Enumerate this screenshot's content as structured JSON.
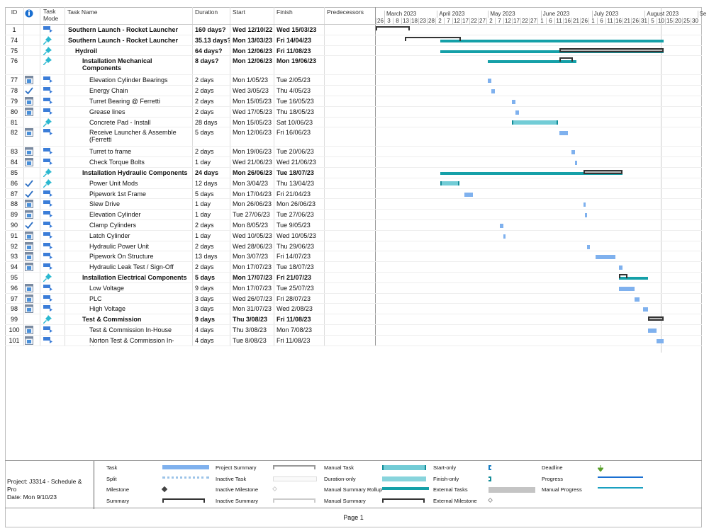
{
  "columns": {
    "id": "ID",
    "info": "i",
    "mode": "Task Mode",
    "name": "Task Name",
    "duration": "Duration",
    "start": "Start",
    "finish": "Finish",
    "predecessors": "Predecessors"
  },
  "timescale": {
    "origin": "2023-02-24",
    "months": [
      {
        "label": "March 2023",
        "date": "2023-03-01"
      },
      {
        "label": "April 2023",
        "date": "2023-04-01"
      },
      {
        "label": "May 2023",
        "date": "2023-05-01"
      },
      {
        "label": "June 2023",
        "date": "2023-06-01"
      },
      {
        "label": "July 2023",
        "date": "2023-07-01"
      },
      {
        "label": "August 2023",
        "date": "2023-08-01"
      },
      {
        "label": "Se",
        "date": "2023-09-01"
      }
    ],
    "days": [
      "26",
      "3",
      "8",
      "13",
      "18",
      "23",
      "28",
      "2",
      "7",
      "12",
      "17",
      "22",
      "27",
      "2",
      "7",
      "12",
      "17",
      "22",
      "27",
      "1",
      "6",
      "11",
      "16",
      "21",
      "26",
      "1",
      "6",
      "11",
      "16",
      "21",
      "26",
      "31",
      "5",
      "10",
      "15",
      "20",
      "25",
      "30"
    ]
  },
  "colors": {
    "task": "#7fb1ee",
    "manual_task": "#72ccd6",
    "rollup": "#15a0a8",
    "summary": "#333333",
    "info": "#1a6fd1",
    "pin": "#2ab8d0"
  },
  "rows": [
    {
      "id": "1",
      "indicator": "",
      "mode": "auto",
      "name": "Southern Launch - Rocket Launcher",
      "duration": "160 days?",
      "start": "Wed 12/10/22",
      "finish": "Wed 15/03/23",
      "bold": true,
      "level": 0,
      "bars": [
        {
          "type": "summary",
          "from": "2023-02-24",
          "to": "2023-03-15"
        }
      ]
    },
    {
      "id": "74",
      "indicator": "",
      "mode": "manual",
      "name": "Southern Launch - Rocket Launcher",
      "duration": "35.13 days?",
      "start": "Mon 13/03/23",
      "finish": "Fri 14/04/23",
      "bold": true,
      "level": 0,
      "bars": [
        {
          "type": "rollup",
          "from": "2023-04-03",
          "to": "2023-08-11"
        },
        {
          "type": "summary",
          "from": "2023-03-13",
          "to": "2023-04-14"
        }
      ]
    },
    {
      "id": "75",
      "indicator": "",
      "mode": "manual",
      "name": "Hydroil",
      "duration": "64 days?",
      "start": "Mon 12/06/23",
      "finish": "Fri 11/08/23",
      "bold": true,
      "level": 1,
      "bars": [
        {
          "type": "rollup",
          "from": "2023-04-03",
          "to": "2023-08-11"
        },
        {
          "type": "msum",
          "from": "2023-06-12",
          "to": "2023-08-11"
        }
      ]
    },
    {
      "id": "76",
      "indicator": "",
      "mode": "manual",
      "name": "Installation Mechanical Components",
      "duration": "8 days?",
      "start": "Mon 12/06/23",
      "finish": "Mon 19/06/23",
      "bold": true,
      "level": 2,
      "bars": [
        {
          "type": "rollup",
          "from": "2023-05-01",
          "to": "2023-06-21"
        },
        {
          "type": "summary",
          "from": "2023-06-12",
          "to": "2023-06-19"
        }
      ]
    },
    {
      "id": "77",
      "indicator": "calendar",
      "mode": "auto",
      "name": "Elevation Cylinder Bearings",
      "duration": "2 days",
      "start": "Mon 1/05/23",
      "finish": "Tue 2/05/23",
      "bold": false,
      "level": 3,
      "bars": [
        {
          "type": "task",
          "from": "2023-05-01",
          "to": "2023-05-02"
        }
      ]
    },
    {
      "id": "78",
      "indicator": "check",
      "mode": "auto",
      "name": "Energy Chain",
      "duration": "2 days",
      "start": "Wed 3/05/23",
      "finish": "Thu 4/05/23",
      "bold": false,
      "level": 3,
      "bars": [
        {
          "type": "task",
          "from": "2023-05-03",
          "to": "2023-05-04"
        }
      ]
    },
    {
      "id": "79",
      "indicator": "calendar",
      "mode": "auto",
      "name": "Turret Bearing @ Ferretti",
      "duration": "2 days",
      "start": "Mon 15/05/23",
      "finish": "Tue 16/05/23",
      "bold": false,
      "level": 3,
      "bars": [
        {
          "type": "task",
          "from": "2023-05-15",
          "to": "2023-05-16"
        }
      ]
    },
    {
      "id": "80",
      "indicator": "calendar",
      "mode": "auto",
      "name": "Grease lines",
      "duration": "2 days",
      "start": "Wed 17/05/23",
      "finish": "Thu 18/05/23",
      "bold": false,
      "level": 3,
      "bars": [
        {
          "type": "task",
          "from": "2023-05-17",
          "to": "2023-05-18"
        }
      ]
    },
    {
      "id": "81",
      "indicator": "",
      "mode": "manual",
      "name": "Concrete Pad - Install",
      "duration": "28 days",
      "start": "Mon 15/05/23",
      "finish": "Sat 10/06/23",
      "bold": false,
      "level": 3,
      "bars": [
        {
          "type": "manual",
          "from": "2023-05-15",
          "to": "2023-06-10"
        }
      ]
    },
    {
      "id": "82",
      "indicator": "calendar",
      "mode": "auto",
      "name": "Receive Launcher & Assemble (Ferretti",
      "duration": "5 days",
      "start": "Mon 12/06/23",
      "finish": "Fri 16/06/23",
      "bold": false,
      "level": 3,
      "bars": [
        {
          "type": "task",
          "from": "2023-06-12",
          "to": "2023-06-16"
        }
      ]
    },
    {
      "id": "83",
      "indicator": "calendar",
      "mode": "auto",
      "name": "Turret to frame",
      "duration": "2 days",
      "start": "Mon 19/06/23",
      "finish": "Tue 20/06/23",
      "bold": false,
      "level": 3,
      "bars": [
        {
          "type": "task",
          "from": "2023-06-19",
          "to": "2023-06-20"
        }
      ]
    },
    {
      "id": "84",
      "indicator": "calendar",
      "mode": "auto",
      "name": "Check Torque Bolts",
      "duration": "1 day",
      "start": "Wed 21/06/23",
      "finish": "Wed 21/06/23",
      "bold": false,
      "level": 3,
      "bars": [
        {
          "type": "task",
          "from": "2023-06-21",
          "to": "2023-06-21"
        }
      ]
    },
    {
      "id": "85",
      "indicator": "",
      "mode": "manual",
      "name": "Installation Hydraulic Components",
      "duration": "24 days",
      "start": "Mon 26/06/23",
      "finish": "Tue 18/07/23",
      "bold": true,
      "level": 2,
      "bars": [
        {
          "type": "rollup",
          "from": "2023-04-03",
          "to": "2023-07-18"
        },
        {
          "type": "msum",
          "from": "2023-06-26",
          "to": "2023-07-18"
        }
      ]
    },
    {
      "id": "86",
      "indicator": "check",
      "mode": "manual",
      "name": "Power Unit Mods",
      "duration": "12 days",
      "start": "Mon 3/04/23",
      "finish": "Thu 13/04/23",
      "bold": false,
      "level": 3,
      "bars": [
        {
          "type": "manual",
          "from": "2023-04-03",
          "to": "2023-04-13"
        }
      ]
    },
    {
      "id": "87",
      "indicator": "check",
      "mode": "auto",
      "name": "Pipework 1st Frame",
      "duration": "5 days",
      "start": "Mon 17/04/23",
      "finish": "Fri 21/04/23",
      "bold": false,
      "level": 3,
      "bars": [
        {
          "type": "task",
          "from": "2023-04-17",
          "to": "2023-04-21"
        }
      ]
    },
    {
      "id": "88",
      "indicator": "calendar",
      "mode": "auto",
      "name": "Slew Drive",
      "duration": "1 day",
      "start": "Mon 26/06/23",
      "finish": "Mon 26/06/23",
      "bold": false,
      "level": 3,
      "bars": [
        {
          "type": "task",
          "from": "2023-06-26",
          "to": "2023-06-26"
        }
      ]
    },
    {
      "id": "89",
      "indicator": "calendar",
      "mode": "auto",
      "name": "Elevation Cylinder",
      "duration": "1 day",
      "start": "Tue 27/06/23",
      "finish": "Tue 27/06/23",
      "bold": false,
      "level": 3,
      "bars": [
        {
          "type": "task",
          "from": "2023-06-27",
          "to": "2023-06-27"
        }
      ]
    },
    {
      "id": "90",
      "indicator": "check",
      "mode": "auto",
      "name": "Clamp Cylinders",
      "duration": "2 days",
      "start": "Mon 8/05/23",
      "finish": "Tue 9/05/23",
      "bold": false,
      "level": 3,
      "bars": [
        {
          "type": "task",
          "from": "2023-05-08",
          "to": "2023-05-09"
        }
      ]
    },
    {
      "id": "91",
      "indicator": "calendar",
      "mode": "auto",
      "name": "Latch Cylinder",
      "duration": "1 day",
      "start": "Wed 10/05/23",
      "finish": "Wed 10/05/23",
      "bold": false,
      "level": 3,
      "bars": [
        {
          "type": "task",
          "from": "2023-05-10",
          "to": "2023-05-10"
        }
      ]
    },
    {
      "id": "92",
      "indicator": "calendar",
      "mode": "auto",
      "name": "Hydraulic Power Unit",
      "duration": "2 days",
      "start": "Wed 28/06/23",
      "finish": "Thu 29/06/23",
      "bold": false,
      "level": 3,
      "bars": [
        {
          "type": "task",
          "from": "2023-06-28",
          "to": "2023-06-29"
        }
      ]
    },
    {
      "id": "93",
      "indicator": "calendar",
      "mode": "auto",
      "name": "Pipework On Structure",
      "duration": "13 days",
      "start": "Mon 3/07/23",
      "finish": "Fri 14/07/23",
      "bold": false,
      "level": 3,
      "bars": [
        {
          "type": "task",
          "from": "2023-07-03",
          "to": "2023-07-14"
        }
      ]
    },
    {
      "id": "94",
      "indicator": "calendar",
      "mode": "auto",
      "name": "Hydraulic Leak Test /  Sign-Off",
      "duration": "2 days",
      "start": "Mon 17/07/23",
      "finish": "Tue 18/07/23",
      "bold": false,
      "level": 3,
      "bars": [
        {
          "type": "task",
          "from": "2023-07-17",
          "to": "2023-07-18"
        }
      ]
    },
    {
      "id": "95",
      "indicator": "",
      "mode": "manual",
      "name": "Installation Electrical Components",
      "duration": "5 days",
      "start": "Mon 17/07/23",
      "finish": "Fri 21/07/23",
      "bold": true,
      "level": 2,
      "bars": [
        {
          "type": "rollup",
          "from": "2023-07-17",
          "to": "2023-08-02"
        },
        {
          "type": "summary",
          "from": "2023-07-17",
          "to": "2023-07-21"
        }
      ]
    },
    {
      "id": "96",
      "indicator": "calendar",
      "mode": "auto",
      "name": "Low Voltage",
      "duration": "9 days",
      "start": "Mon 17/07/23",
      "finish": "Tue 25/07/23",
      "bold": false,
      "level": 3,
      "bars": [
        {
          "type": "task",
          "from": "2023-07-17",
          "to": "2023-07-25"
        }
      ]
    },
    {
      "id": "97",
      "indicator": "calendar",
      "mode": "auto",
      "name": "PLC",
      "duration": "3 days",
      "start": "Wed 26/07/23",
      "finish": "Fri 28/07/23",
      "bold": false,
      "level": 3,
      "bars": [
        {
          "type": "task",
          "from": "2023-07-26",
          "to": "2023-07-28"
        }
      ]
    },
    {
      "id": "98",
      "indicator": "calendar",
      "mode": "auto",
      "name": "High Voltage",
      "duration": "3 days",
      "start": "Mon 31/07/23",
      "finish": "Wed 2/08/23",
      "bold": false,
      "level": 3,
      "bars": [
        {
          "type": "task",
          "from": "2023-07-31",
          "to": "2023-08-02"
        }
      ]
    },
    {
      "id": "99",
      "indicator": "",
      "mode": "manual",
      "name": "Test & Commission",
      "duration": "9 days",
      "start": "Thu 3/08/23",
      "finish": "Fri 11/08/23",
      "bold": true,
      "level": 2,
      "bars": [
        {
          "type": "msum",
          "from": "2023-08-03",
          "to": "2023-08-11"
        }
      ]
    },
    {
      "id": "100",
      "indicator": "calendar",
      "mode": "auto",
      "name": "Test & Commission In-House",
      "duration": "4 days",
      "start": "Thu 3/08/23",
      "finish": "Mon 7/08/23",
      "bold": false,
      "level": 3,
      "bars": [
        {
          "type": "task",
          "from": "2023-08-03",
          "to": "2023-08-07"
        }
      ]
    },
    {
      "id": "101",
      "indicator": "calendar",
      "mode": "auto",
      "name": "Norton Test & Commission In-House",
      "duration": "4 days",
      "start": "Tue 8/08/23",
      "finish": "Fri 11/08/23",
      "bold": false,
      "level": 3,
      "bars": [
        {
          "type": "task",
          "from": "2023-08-08",
          "to": "2023-08-11"
        }
      ]
    }
  ],
  "legend": {
    "project": "Project: J3314 - Schedule & Pro",
    "date": "Date: Mon 9/10/23",
    "items": [
      {
        "label": "Task",
        "kind": "task"
      },
      {
        "label": "Split",
        "kind": "split"
      },
      {
        "label": "Milestone",
        "kind": "milestone"
      },
      {
        "label": "Summary",
        "kind": "summary"
      },
      {
        "label": "Project Summary",
        "kind": "projsum"
      },
      {
        "label": "Inactive Task",
        "kind": "inactive"
      },
      {
        "label": "Inactive Milestone",
        "kind": "inmilestone"
      },
      {
        "label": "Inactive Summary",
        "kind": "insummary"
      },
      {
        "label": "Manual Task",
        "kind": "manual"
      },
      {
        "label": "Duration-only",
        "kind": "duronly"
      },
      {
        "label": "Manual Summary Rollup",
        "kind": "rollup"
      },
      {
        "label": "Manual Summary",
        "kind": "summary"
      },
      {
        "label": "Start-only",
        "kind": "startonly"
      },
      {
        "label": "Finish-only",
        "kind": "finishonly"
      },
      {
        "label": "External Tasks",
        "kind": "external"
      },
      {
        "label": "External Milestone",
        "kind": "extmilestone"
      },
      {
        "label": "Deadline",
        "kind": "deadline"
      },
      {
        "label": "Progress",
        "kind": "progress"
      },
      {
        "label": "Manual Progress",
        "kind": "mprogress"
      }
    ]
  },
  "footer": {
    "page": "Page 1"
  }
}
